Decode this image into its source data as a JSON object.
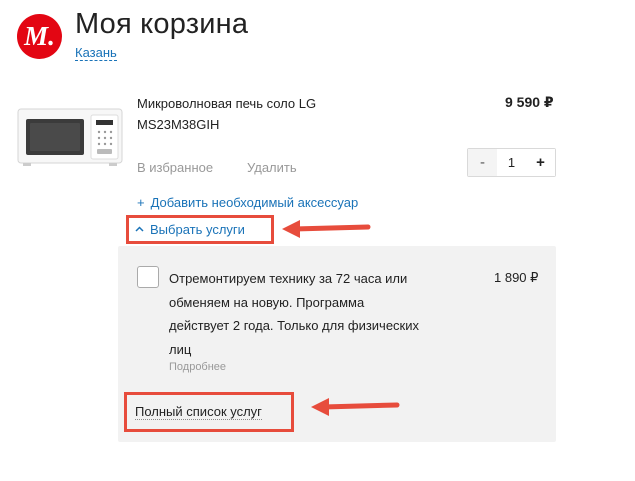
{
  "header": {
    "logo_text": "M",
    "logo_dot": ".",
    "title": "Моя корзина",
    "city": "Казань"
  },
  "product": {
    "name": "Микроволновая печь соло LG MS23M38GIH",
    "price": "9 590 ₽",
    "favorites_label": "В избранное",
    "delete_label": "Удалить",
    "quantity": "1",
    "minus_label": "-",
    "plus_label": "+",
    "accessory_plus": "+",
    "accessory_label": "Добавить необходимый аксессуар"
  },
  "services": {
    "toggle_label": "Выбрать услуги",
    "item": {
      "description": "Отремонтируем технику за 72 часа или обменяем на новую. Программа действует 2 года. Только для физических лиц",
      "more_label": "Подробнее",
      "price": "1 890 ₽"
    },
    "full_list_label": "Полный список услуг"
  },
  "colors": {
    "brand": "#e30613",
    "link": "#1a73b8",
    "annotation": "#e74c3c"
  }
}
